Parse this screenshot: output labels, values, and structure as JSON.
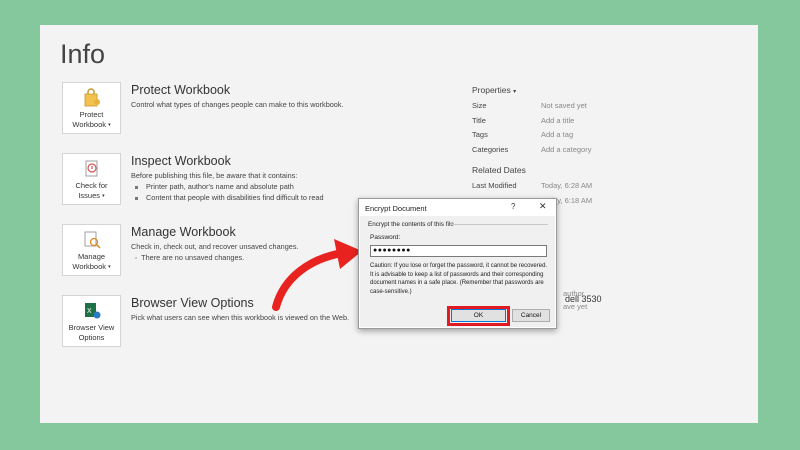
{
  "page": {
    "title": "Info"
  },
  "sections": {
    "protect": {
      "tile_line1": "Protect",
      "tile_line2": "Workbook",
      "heading": "Protect Workbook",
      "desc": "Control what types of changes people can make to this workbook."
    },
    "inspect": {
      "tile_line1": "Check for",
      "tile_line2": "Issues",
      "heading": "Inspect Workbook",
      "desc": "Before publishing this file, be aware that it contains:",
      "bullets": [
        "Printer path, author's name and absolute path",
        "Content that people with disabilities find difficult to read"
      ]
    },
    "manage": {
      "tile_line1": "Manage",
      "tile_line2": "Workbook",
      "heading": "Manage Workbook",
      "desc": "Check in, check out, and recover unsaved changes.",
      "status": "There are no unsaved changes."
    },
    "browser": {
      "tile_line1": "Browser View",
      "tile_line2": "Options",
      "heading": "Browser View Options",
      "desc": "Pick what users can see when this workbook is viewed on the Web."
    }
  },
  "properties": {
    "heading": "Properties",
    "rows": [
      {
        "key": "Size",
        "value": "Not saved yet"
      },
      {
        "key": "Title",
        "value": "Add a title"
      },
      {
        "key": "Tags",
        "value": "Add a tag"
      },
      {
        "key": "Categories",
        "value": "Add a category"
      }
    ],
    "related_heading": "Related Dates",
    "dates": [
      {
        "key": "Last Modified",
        "value": "Today, 6:28 AM"
      },
      {
        "key": "",
        "value": "Today, 6:18 AM"
      }
    ],
    "people_fragment_1": "author",
    "people_fragment_2": "dell 3530",
    "people_fragment_3": "ave yet"
  },
  "dialog": {
    "title": "Encrypt Document",
    "help": "?",
    "close": "✕",
    "subheading": "Encrypt the contents of this file",
    "password_label": "Password:",
    "password_value": "●●●●●●●●",
    "caution": "Caution: If you lose or forget the password, it cannot be recovered. It is advisable to keep a list of passwords and their corresponding document names in a safe place. (Remember that passwords are case-sensitive.)",
    "ok_label": "OK",
    "cancel_label": "Cancel"
  },
  "colors": {
    "background": "#86c89d",
    "highlight": "#e01b24",
    "arrow": "#e8231f"
  }
}
